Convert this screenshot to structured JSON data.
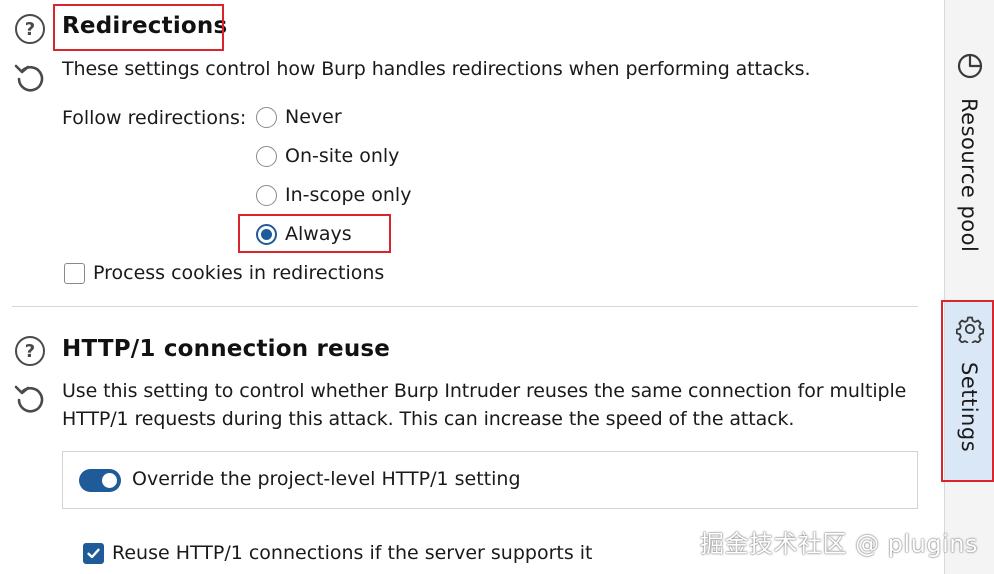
{
  "redirections": {
    "title": "Redirections",
    "description": "These settings control how Burp handles redirections when performing attacks.",
    "follow_label": "Follow redirections:",
    "options": [
      {
        "label": "Never",
        "checked": false
      },
      {
        "label": "On-site only",
        "checked": false
      },
      {
        "label": "In-scope only",
        "checked": false
      },
      {
        "label": "Always",
        "checked": true
      }
    ],
    "process_cookies": {
      "label": "Process cookies in redirections",
      "checked": false
    }
  },
  "http1_reuse": {
    "title": "HTTP/1 connection reuse",
    "description_line1": "Use this setting to control whether Burp Intruder reuses the same connection for multiple",
    "description_line2": "HTTP/1 requests during this attack. This can increase the speed of the attack.",
    "override": {
      "label": "Override the project-level HTTP/1 setting",
      "enabled": true
    },
    "reuse": {
      "label": "Reuse HTTP/1 connections if the server supports it",
      "checked": true
    }
  },
  "sidebar": {
    "tabs": [
      {
        "label": "Resource pool",
        "icon": "pie-chart-icon",
        "selected": false
      },
      {
        "label": "Settings",
        "icon": "gear-icon",
        "selected": true
      }
    ]
  },
  "watermark": "掘金技术社区 @ plugins",
  "colors": {
    "accent": "#1f5b99",
    "highlight_box": "#d9262e",
    "selected_tab_bg": "#d9e7f7"
  }
}
